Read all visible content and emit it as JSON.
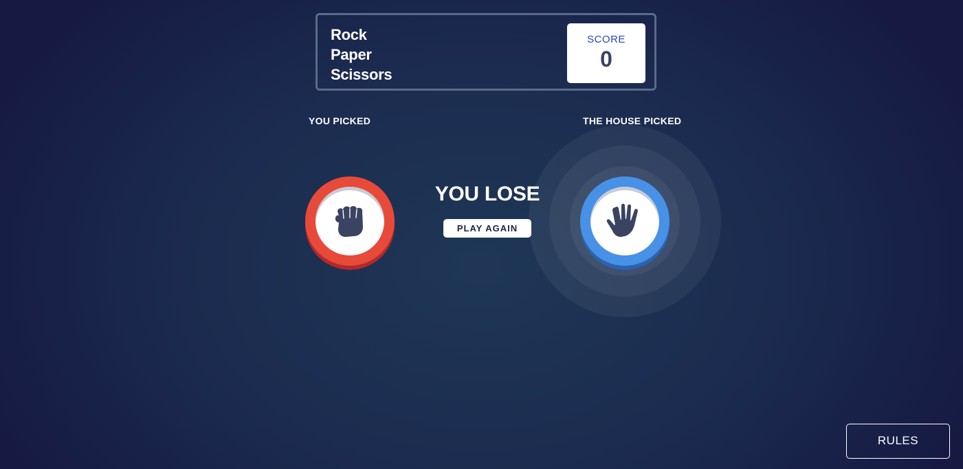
{
  "header": {
    "title_lines": [
      "Rock",
      "Paper",
      "Scissors"
    ],
    "score_label": "SCORE",
    "score_value": "0"
  },
  "player": {
    "label": "YOU PICKED",
    "choice": "rock",
    "icon": "rock-icon",
    "color": "#e84a3a"
  },
  "house": {
    "label": "THE HOUSE PICKED",
    "choice": "paper",
    "icon": "paper-icon",
    "color": "#4791e6"
  },
  "result": {
    "text": "YOU LOSE",
    "play_again_label": "PLAY AGAIN"
  },
  "rules_label": "RULES",
  "colors": {
    "background": "#1b2b4f",
    "score_label": "#2b46c0",
    "score_value": "#3b4363"
  }
}
